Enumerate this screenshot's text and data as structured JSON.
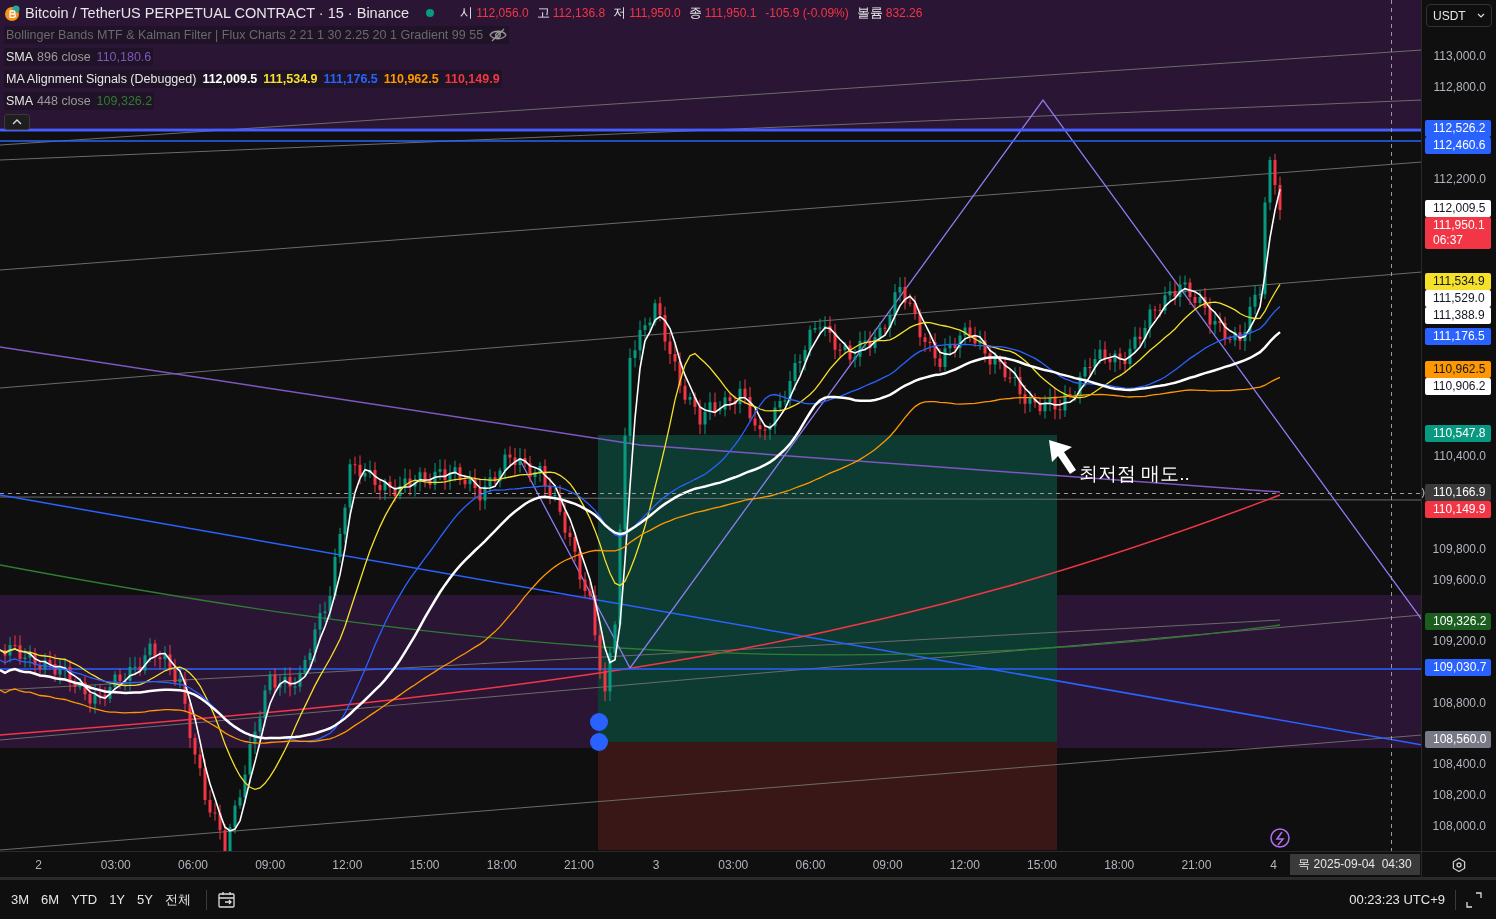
{
  "header": {
    "title": "Bitcoin / TetherUS PERPETUAL CONTRACT · 15 · Binance",
    "market_open": true,
    "ohlc": [
      {
        "label": "시",
        "value": "112,056.0"
      },
      {
        "label": "고",
        "value": "112,136.8"
      },
      {
        "label": "저",
        "value": "111,950.0"
      },
      {
        "label": "종",
        "value": "111,950.1"
      }
    ],
    "change": "-105.9 (-0.09%)",
    "volume_label": "볼륨",
    "volume": "832.26"
  },
  "legend": [
    {
      "name": "Bollinger Bands MTF & Kalman Filter | Flux Charts 2 21 1 30 2.25 20 1 Gradient 99 55",
      "visible": false
    },
    {
      "name": "SMA",
      "params": "896 close",
      "visible": true,
      "values": [
        {
          "text": "110,180.6",
          "color": "#7e57c2"
        }
      ]
    },
    {
      "name": "MA Alignment Signals (Debugged)",
      "visible": true,
      "values": [
        {
          "text": "112,009.5",
          "color": "#ffffff"
        },
        {
          "text": "111,534.9",
          "color": "#f5e02a"
        },
        {
          "text": "111,176.5",
          "color": "#2962ff"
        },
        {
          "text": "110,962.5",
          "color": "#ff9800"
        },
        {
          "text": "110,149.9",
          "color": "#f23645"
        }
      ]
    },
    {
      "name": "SMA",
      "params": "448 close",
      "visible": true,
      "values": [
        {
          "text": "109,326.2",
          "color": "#2e7d32"
        }
      ]
    }
  ],
  "annotation": "최저점 매도..",
  "price_axis": {
    "currency": "USDT",
    "ticks": [
      "113,000.0",
      "112,800.0",
      "112,200.0",
      "110,400.0",
      "109,800.0",
      "109,600.0",
      "109,200.0",
      "108,800.0",
      "108,400.0",
      "108,200.0",
      "108,000.0"
    ],
    "badges": [
      {
        "text": "112,526.2",
        "color": "#2962ff"
      },
      {
        "text": "112,460.6",
        "color": "#2962ff"
      },
      {
        "text": "112,009.5",
        "color": "#ffffff"
      },
      {
        "text": "111,950.1",
        "sub": "06:37",
        "color": "#f23645"
      },
      {
        "text": "111,534.9",
        "color": "#f5e02a"
      },
      {
        "text": "111,529.0",
        "color": "#ffffff"
      },
      {
        "text": "111,388.9",
        "color": "#ffffff"
      },
      {
        "text": "111,176.5",
        "color": "#2962ff"
      },
      {
        "text": "110,962.5",
        "color": "#ff9800"
      },
      {
        "text": "110,906.2",
        "color": "#ffffff"
      },
      {
        "text": "110,547.8",
        "color": "#089981"
      },
      {
        "text": "110,166.9",
        "color": "#3a3a3a"
      },
      {
        "text": "110,149.9",
        "color": "#f23645"
      },
      {
        "text": "109,326.2",
        "color": "#1b5e20"
      },
      {
        "text": "109,030.7",
        "color": "#2962ff"
      },
      {
        "text": "108,560.0",
        "color": "#787b86"
      }
    ]
  },
  "time_axis": {
    "labels": [
      "2",
      "03:00",
      "06:00",
      "09:00",
      "12:00",
      "15:00",
      "18:00",
      "21:00",
      "3",
      "03:00",
      "06:00",
      "09:00",
      "12:00",
      "15:00",
      "18:00",
      "21:00",
      "4"
    ],
    "crosshair": "목 2025-09-04  04:30"
  },
  "toolbar": {
    "ranges": [
      "3M",
      "6M",
      "YTD",
      "1Y",
      "5Y",
      "전체"
    ],
    "clock": "00:23:23 UTC+9"
  }
}
